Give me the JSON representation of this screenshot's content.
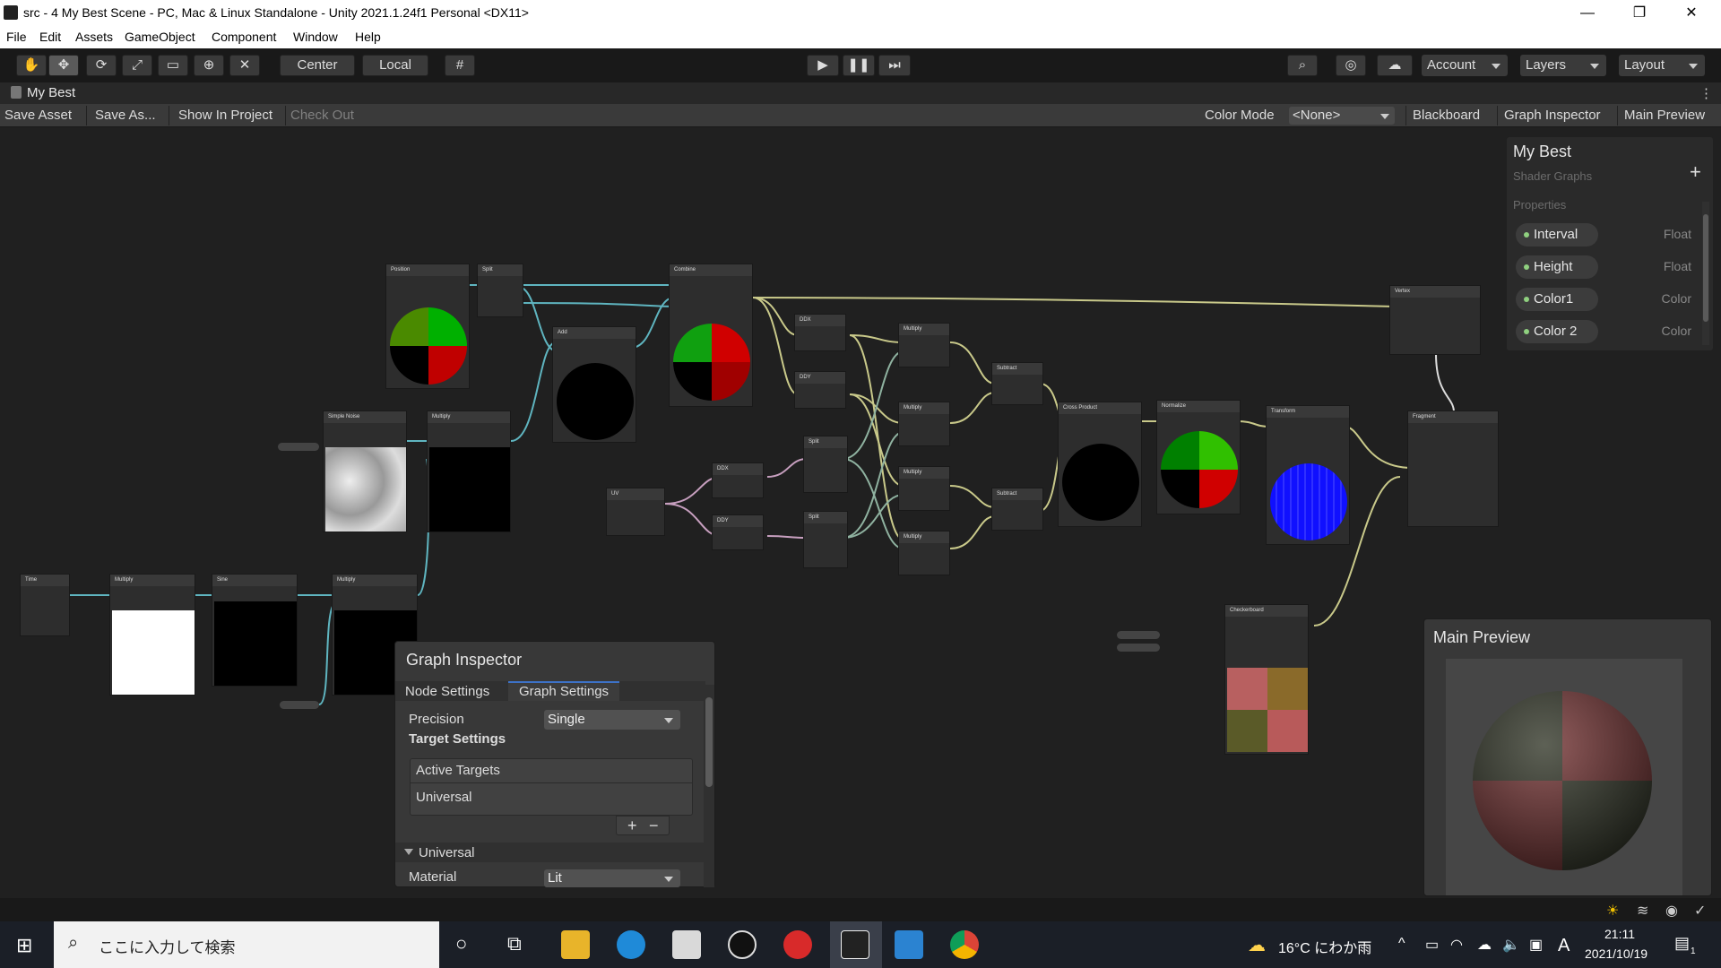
{
  "window": {
    "title": "src - 4 My Best Scene - PC, Mac & Linux Standalone - Unity 2021.1.24f1 Personal <DX11>",
    "minimize": "—",
    "restore": "❐",
    "close": "✕"
  },
  "menu": [
    "File",
    "Edit",
    "Assets",
    "GameObject",
    "Component",
    "Window",
    "Help"
  ],
  "toolbar": {
    "pivot": "Center",
    "space": "Local",
    "account": "Account",
    "layers": "Layers",
    "layout": "Layout"
  },
  "tab": {
    "title": "My Best",
    "more": "⋮"
  },
  "graphbar": {
    "save_asset": "Save Asset",
    "save_as": "Save As...",
    "show_in_project": "Show In Project",
    "check_out": "Check Out",
    "color_mode_label": "Color Mode",
    "color_mode_value": "<None>",
    "blackboard": "Blackboard",
    "graph_inspector": "Graph Inspector",
    "main_preview": "Main Preview"
  },
  "blackboard": {
    "title": "My Best",
    "subtitle": "Shader Graphs",
    "add": "+",
    "section": "Properties",
    "properties": [
      {
        "name": "Interval",
        "type": "Float"
      },
      {
        "name": "Height",
        "type": "Float"
      },
      {
        "name": "Color1",
        "type": "Color"
      },
      {
        "name": "Color 2",
        "type": "Color"
      }
    ]
  },
  "nodes": {
    "position": "Position",
    "split": "Split",
    "combine": "Combine",
    "add": "Add",
    "simple_noise": "Simple Noise",
    "multiply": "Multiply",
    "uv": "UV",
    "ddx": "DDX",
    "ddy": "DDY",
    "subtract": "Subtract",
    "cross_product": "Cross Product",
    "normalize": "Normalize",
    "transform": "Transform",
    "vertex": "Vertex",
    "fragment": "Fragment",
    "time": "Time",
    "sine": "Sine",
    "checkerboard": "Checkerboard"
  },
  "inspector": {
    "title": "Graph Inspector",
    "tab_node": "Node Settings",
    "tab_graph": "Graph Settings",
    "precision_label": "Precision",
    "precision_value": "Single",
    "target_settings": "Target Settings",
    "active_targets": "Active Targets",
    "universal_item": "Universal",
    "plus": "+",
    "minus": "−",
    "universal_section": "Universal",
    "material_label": "Material",
    "material_value": "Lit"
  },
  "main_preview": {
    "title": "Main Preview"
  },
  "taskbar": {
    "search_placeholder": "ここに入力して検索",
    "weather": "16°C  にわか雨",
    "ime": "A",
    "time": "21:11",
    "date": "2021/10/19",
    "notif_count": "1"
  },
  "colors": {
    "accent": "#3d72c7",
    "wire_green": "#8fb2a0",
    "wire_teal": "#5fb5c0",
    "wire_yellow": "#c9c98a",
    "wire_purple": "#c79fbf"
  }
}
